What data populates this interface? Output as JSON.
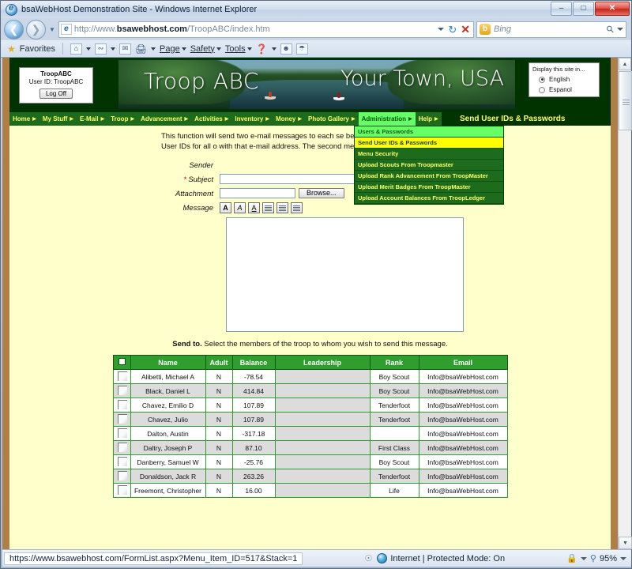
{
  "window": {
    "title": "bsaWebHost Demonstration Site - Windows Internet Explorer",
    "minimize_label": "–",
    "maximize_label": "□",
    "close_label": "✕"
  },
  "address_bar": {
    "url_prefix": "http://www.",
    "url_domain": "bsawebhost.com",
    "url_path": "/TroopABC/index.htm",
    "search_placeholder": "Bing"
  },
  "command_bar": {
    "favorites_label": "Favorites",
    "items": [
      {
        "label": "Page",
        "icon": "page-icon"
      },
      {
        "label": "Safety",
        "icon": "shield-icon"
      },
      {
        "label": "Tools",
        "icon": "tools-icon"
      }
    ],
    "home_icon": "home-icon",
    "feeds_icon": "feeds-icon",
    "read_mail_icon": "mail-icon",
    "print_icon": "printer-icon",
    "help_icon": "help-icon",
    "extra_icon_1": "messenger-icon",
    "extra_icon_2": "reader-icon"
  },
  "site": {
    "user_box": {
      "troop": "TroopABC",
      "user_id_label": "User ID:  TroopABC",
      "log_off": "Log Off"
    },
    "banner": {
      "troop_name": "Troop ABC",
      "town": "Your Town, USA"
    },
    "language_box": {
      "heading": "Display this site in...",
      "options": [
        {
          "label": "English",
          "selected": true
        },
        {
          "label": "Espanol",
          "selected": false
        }
      ]
    },
    "nav": [
      {
        "label": "Home",
        "active": false
      },
      {
        "label": "My Stuff",
        "active": false
      },
      {
        "label": "E-Mail",
        "active": false
      },
      {
        "label": "Troop",
        "active": false
      },
      {
        "label": "Advancement",
        "active": false
      },
      {
        "label": "Activities",
        "active": false
      },
      {
        "label": "Inventory",
        "active": false
      },
      {
        "label": "Money",
        "active": false
      },
      {
        "label": "Photo Gallery",
        "active": false
      },
      {
        "label": "Administration",
        "active": true
      },
      {
        "label": "Help",
        "active": false
      }
    ],
    "page_title": "Send User IDs & Passwords",
    "dropdown": [
      {
        "label": "Users & Passwords",
        "state": "hover-green"
      },
      {
        "label": "Send User IDs & Passwords",
        "state": "selected-yellow"
      },
      {
        "label": "Menu Security",
        "state": "normal"
      },
      {
        "label": "Upload Scouts From Troopmaster",
        "state": "normal"
      },
      {
        "label": "Upload Rank Advancement From TroopMaster",
        "state": "normal"
      },
      {
        "label": "Upload Merit Badges From TroopMaster",
        "state": "normal"
      },
      {
        "label": "Upload Account Balances From TroopLedger",
        "state": "normal"
      }
    ]
  },
  "form": {
    "intro": "This function will send two e-mail messages to each se below. The first will contain all of the User IDs for all o with that e-mail address. The second message will con passwords.",
    "fields": {
      "sender_label": "Sender",
      "sender_value": "",
      "subject_label": "Subject",
      "subject_value": "",
      "subject_required": "*",
      "attachment_label": "Attachment",
      "attachment_value": "",
      "browse_label": "Browse...",
      "message_label": "Message",
      "message_value": ""
    },
    "editor_buttons": [
      {
        "name": "bold-button",
        "glyph": "A"
      },
      {
        "name": "italic-button",
        "glyph": "A"
      },
      {
        "name": "underline-button",
        "glyph": "A"
      },
      {
        "name": "align-left-button",
        "glyph": "lines"
      },
      {
        "name": "align-center-button",
        "glyph": "lines"
      },
      {
        "name": "align-right-button",
        "glyph": "lines"
      }
    ]
  },
  "send_to": {
    "bold_label": "Send to.",
    "text": "Select the members of the troop to whom you wish to send this message."
  },
  "roster": {
    "columns": [
      "",
      "Name",
      "Adult",
      "Balance",
      "Leadership",
      "Rank",
      "Email"
    ],
    "select_all_checked": false,
    "rows": [
      {
        "name": "Alibetti, Michael A",
        "adult": "N",
        "balance": "-78.54",
        "leadership": "",
        "rank": "Boy Scout",
        "email": "Info@bsaWebHost.com"
      },
      {
        "name": "Black, Daniel L",
        "adult": "N",
        "balance": "414.84",
        "leadership": "",
        "rank": "Boy Scout",
        "email": "Info@bsaWebHost.com"
      },
      {
        "name": "Chavez, Emilio D",
        "adult": "N",
        "balance": "107.89",
        "leadership": "",
        "rank": "Tenderfoot",
        "email": "Info@bsaWebHost.com"
      },
      {
        "name": "Chavez, Julio",
        "adult": "N",
        "balance": "107.89",
        "leadership": "",
        "rank": "Tenderfoot",
        "email": "Info@bsaWebHost.com"
      },
      {
        "name": "Dalton, Austin",
        "adult": "N",
        "balance": "-317.18",
        "leadership": "",
        "rank": "",
        "email": "Info@bsaWebHost.com"
      },
      {
        "name": "Daltry, Joseph P",
        "adult": "N",
        "balance": "87.10",
        "leadership": "",
        "rank": "First Class",
        "email": "Info@bsaWebHost.com"
      },
      {
        "name": "Danberry, Samuel W",
        "adult": "N",
        "balance": "-25.76",
        "leadership": "",
        "rank": "Boy Scout",
        "email": "Info@bsaWebHost.com"
      },
      {
        "name": "Donaldson, Jack R",
        "adult": "N",
        "balance": "263.26",
        "leadership": "",
        "rank": "Tenderfoot",
        "email": "Info@bsaWebHost.com"
      },
      {
        "name": "Freemont, Christopher",
        "adult": "N",
        "balance": "16.00",
        "leadership": "",
        "rank": "Life",
        "email": "Info@bsaWebHost.com"
      }
    ]
  },
  "status_bar": {
    "url": "https://www.bsawebhost.com/FormList.aspx?Menu_Item_ID=517&Stack=1",
    "zone": "Internet | Protected Mode: On",
    "zoom": "95%"
  }
}
